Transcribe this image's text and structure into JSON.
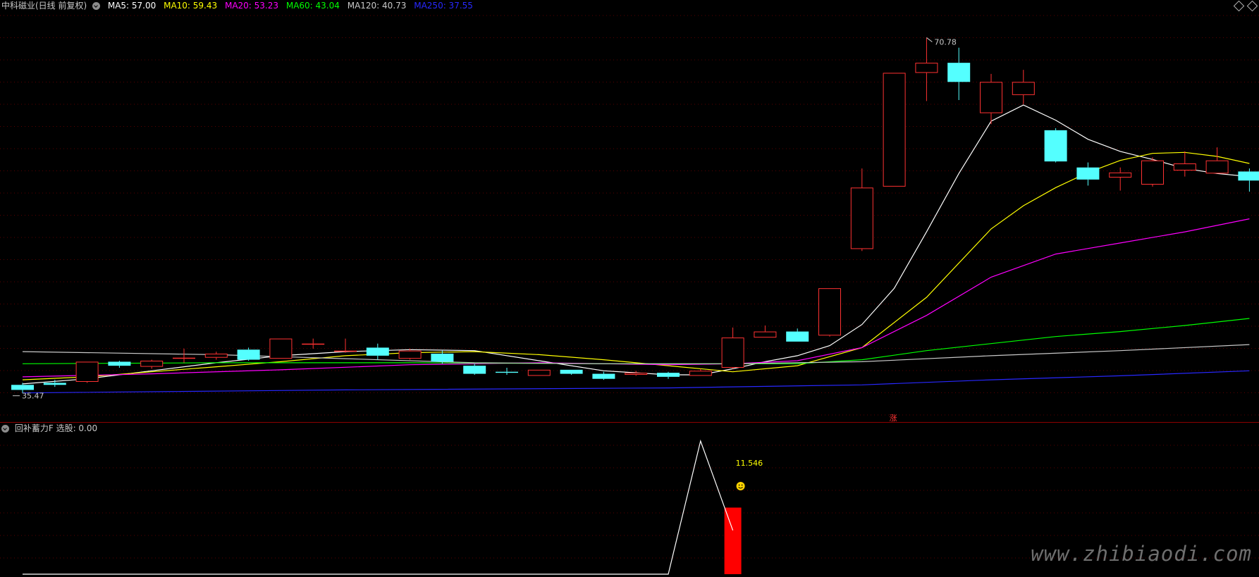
{
  "header": {
    "title": "中科磁业(日线 前复权)",
    "ma_items": [
      {
        "label": "MA5: 57.00",
        "color": "#ffffff"
      },
      {
        "label": "MA10: 59.43",
        "color": "#ffff00"
      },
      {
        "label": "MA20: 53.23",
        "color": "#ff00ff"
      },
      {
        "label": "MA60: 43.04",
        "color": "#00ff00"
      },
      {
        "label": "MA120: 40.73",
        "color": "#c8c8c8"
      },
      {
        "label": "MA250: 37.55",
        "color": "#2828ff"
      }
    ]
  },
  "indicator_header": {
    "title": "回补蓄力F",
    "value_label": "选股: 0.00"
  },
  "watermark": "www.zhibiaodi.com",
  "chart_data": [
    {
      "type": "candlestick",
      "ylim": [
        34.5,
        73
      ],
      "grid": true,
      "annotations": {
        "high_label": "70.78",
        "low_label": "35.47",
        "limit_up_marker": "涨"
      },
      "candles": [
        {
          "o": 36.3,
          "c": 35.8,
          "h": 36.5,
          "l": 35.5
        },
        {
          "o": 36.5,
          "c": 36.3,
          "h": 36.8,
          "l": 36.1
        },
        {
          "o": 36.6,
          "c": 38.6,
          "h": 38.6,
          "l": 36.5
        },
        {
          "o": 38.6,
          "c": 38.2,
          "h": 38.7,
          "l": 38.0
        },
        {
          "o": 38.1,
          "c": 38.7,
          "h": 38.8,
          "l": 37.9
        },
        {
          "o": 38.9,
          "c": 39.0,
          "h": 39.9,
          "l": 38.5
        },
        {
          "o": 39.0,
          "c": 39.4,
          "h": 39.6,
          "l": 38.8
        },
        {
          "o": 39.8,
          "c": 38.8,
          "h": 40.0,
          "l": 38.7
        },
        {
          "o": 38.9,
          "c": 40.9,
          "h": 40.9,
          "l": 38.9
        },
        {
          "o": 40.3,
          "c": 40.4,
          "h": 40.9,
          "l": 39.9
        },
        {
          "o": 39.6,
          "c": 39.7,
          "h": 40.9,
          "l": 39.5
        },
        {
          "o": 40.0,
          "c": 39.2,
          "h": 40.4,
          "l": 38.8
        },
        {
          "o": 38.9,
          "c": 39.7,
          "h": 39.9,
          "l": 38.8
        },
        {
          "o": 39.4,
          "c": 38.6,
          "h": 39.7,
          "l": 38.4
        },
        {
          "o": 38.2,
          "c": 37.4,
          "h": 38.4,
          "l": 37.3
        },
        {
          "o": 37.6,
          "c": 37.5,
          "h": 38.0,
          "l": 37.3
        },
        {
          "o": 37.2,
          "c": 37.8,
          "h": 37.8,
          "l": 37.2
        },
        {
          "o": 37.8,
          "c": 37.4,
          "h": 37.8,
          "l": 37.3
        },
        {
          "o": 37.4,
          "c": 36.9,
          "h": 37.6,
          "l": 36.8
        },
        {
          "o": 37.3,
          "c": 37.5,
          "h": 37.7,
          "l": 37.2
        },
        {
          "o": 37.5,
          "c": 37.1,
          "h": 37.6,
          "l": 36.9
        },
        {
          "o": 37.2,
          "c": 37.7,
          "h": 37.9,
          "l": 37.2
        },
        {
          "o": 38.0,
          "c": 41.0,
          "h": 42.0,
          "l": 37.9
        },
        {
          "o": 41.0,
          "c": 41.6,
          "h": 42.2,
          "l": 41.0
        },
        {
          "o": 41.6,
          "c": 40.6,
          "h": 41.9,
          "l": 40.6
        },
        {
          "o": 41.2,
          "c": 45.9,
          "h": 45.9,
          "l": 41.1
        },
        {
          "o": 49.8,
          "c": 55.9,
          "h": 57.8,
          "l": 49.6
        },
        {
          "o": 56.0,
          "c": 67.3,
          "h": 67.3,
          "l": 56.0
        },
        {
          "o": 67.3,
          "c": 68.3,
          "h": 70.8,
          "l": 64.5
        },
        {
          "o": 68.3,
          "c": 66.4,
          "h": 69.8,
          "l": 64.6
        },
        {
          "o": 63.3,
          "c": 66.4,
          "h": 67.2,
          "l": 62.2
        },
        {
          "o": 65.1,
          "c": 66.4,
          "h": 67.6,
          "l": 64.2
        },
        {
          "o": 61.6,
          "c": 58.5,
          "h": 61.8,
          "l": 58.4
        },
        {
          "o": 57.9,
          "c": 56.7,
          "h": 58.4,
          "l": 56.1
        },
        {
          "o": 56.9,
          "c": 57.4,
          "h": 57.9,
          "l": 55.6
        },
        {
          "o": 56.2,
          "c": 58.6,
          "h": 58.9,
          "l": 56.0
        },
        {
          "o": 57.6,
          "c": 58.3,
          "h": 59.5,
          "l": 57.0
        },
        {
          "o": 57.3,
          "c": 58.6,
          "h": 59.9,
          "l": 57.3
        },
        {
          "o": 57.5,
          "c": 56.6,
          "h": 57.8,
          "l": 55.5
        }
      ],
      "series": [
        {
          "name": "MA5",
          "color": "#ffffff",
          "x": [
            0,
            2,
            4,
            6,
            8,
            10,
            12,
            14,
            16,
            18,
            20,
            21,
            22,
            23,
            24,
            25,
            26,
            27,
            28,
            29,
            30,
            31,
            32,
            33,
            34,
            35,
            36,
            37,
            38
          ],
          "values": [
            36.4,
            36.9,
            37.7,
            38.5,
            39.2,
            39.6,
            39.8,
            39.7,
            38.7,
            37.7,
            37.3,
            37.3,
            37.9,
            38.6,
            39.2,
            40.2,
            42.3,
            45.9,
            51.5,
            57.3,
            62.5,
            64.1,
            62.6,
            60.7,
            59.5,
            58.7,
            57.8,
            57.3,
            57.0
          ]
        },
        {
          "name": "MA10",
          "color": "#ffff00",
          "x": [
            0,
            2,
            4,
            6,
            8,
            10,
            12,
            14,
            16,
            18,
            20,
            22,
            24,
            26,
            28,
            30,
            31,
            32,
            33,
            34,
            35,
            36,
            37,
            38
          ],
          "values": [
            36.8,
            37.1,
            37.6,
            38.1,
            38.6,
            39.2,
            39.5,
            39.6,
            39.3,
            38.8,
            38.2,
            37.6,
            38.2,
            40.0,
            45.0,
            51.8,
            54.1,
            55.9,
            57.4,
            58.6,
            59.3,
            59.4,
            59.0,
            58.3
          ]
        },
        {
          "name": "MA20",
          "color": "#ff00ff",
          "x": [
            0,
            4,
            8,
            12,
            16,
            20,
            22,
            24,
            26,
            28,
            30,
            32,
            34,
            36,
            38
          ],
          "values": [
            37.1,
            37.4,
            37.8,
            38.3,
            38.5,
            38.3,
            38.4,
            38.7,
            40.0,
            43.2,
            47.0,
            49.3,
            50.4,
            51.5,
            52.8
          ]
        },
        {
          "name": "MA60",
          "color": "#00ff00",
          "x": [
            0,
            6,
            12,
            18,
            24,
            26,
            28,
            30,
            32,
            34,
            36,
            38
          ],
          "values": [
            38.4,
            38.5,
            38.5,
            38.4,
            38.4,
            38.8,
            39.7,
            40.4,
            41.1,
            41.6,
            42.2,
            42.9
          ]
        },
        {
          "name": "MA120",
          "color": "#c8c8c8",
          "x": [
            0,
            6,
            10,
            14,
            18,
            22,
            26,
            30,
            34,
            38
          ],
          "values": [
            39.6,
            39.3,
            38.9,
            38.5,
            38.4,
            38.4,
            38.6,
            39.2,
            39.7,
            40.3
          ]
        },
        {
          "name": "MA250",
          "color": "#2828ff",
          "x": [
            0,
            10,
            20,
            22,
            26,
            30,
            34,
            38
          ],
          "values": [
            35.5,
            35.8,
            36.0,
            36.1,
            36.3,
            36.8,
            37.2,
            37.7
          ]
        }
      ]
    },
    {
      "type": "indicator",
      "ylim": [
        0,
        16
      ],
      "line_x": [
        0,
        20,
        21,
        22
      ],
      "line_values": [
        0,
        0,
        15.2,
        5
      ],
      "bars": [
        {
          "x": 22,
          "value": 7.6
        }
      ],
      "value_label": "11.546"
    }
  ]
}
